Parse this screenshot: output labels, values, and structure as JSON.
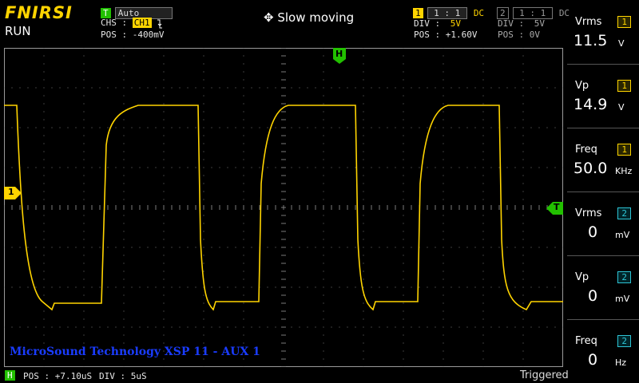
{
  "brand": "FNIRSI",
  "state": "RUN",
  "trigger": {
    "tag": "T",
    "mode": "Auto",
    "chs_label": "CHS :",
    "chs_value": "CH1",
    "edge_icon": "falling-edge-icon",
    "pos_label": "POS :",
    "pos_value": "-400mV"
  },
  "move_mode": "Slow moving",
  "ch1": {
    "num": "1",
    "probe": "1 : 1",
    "coupling": "DC",
    "div_label": "DIV :",
    "div": "5V",
    "pos_label": "POS :",
    "pos": "+1.60V"
  },
  "ch2": {
    "num": "2",
    "probe": "1 : 1",
    "coupling": "DC",
    "div_label": "DIV :",
    "div": "5V",
    "pos_label": "POS :",
    "pos": "0V"
  },
  "markers": {
    "h": "H",
    "ch1": "1",
    "t": "T"
  },
  "watermark": "MicroSound Technology XSP 11 - AUX 1",
  "bottom": {
    "h": "H",
    "pos_label": "POS :",
    "pos": "+7.10uS",
    "div_label": "DIV :",
    "div": "5uS",
    "status": "Triggered"
  },
  "measurements": [
    {
      "label": "Vrms",
      "ch": "1",
      "value": "11.5",
      "unit": "V"
    },
    {
      "label": "Vp",
      "ch": "1",
      "value": "14.9",
      "unit": "V"
    },
    {
      "label": "Freq",
      "ch": "1",
      "value": "50.0",
      "unit": "KHz"
    },
    {
      "label": "Vrms",
      "ch": "2",
      "value": "0",
      "unit": "mV"
    },
    {
      "label": "Vp",
      "ch": "2",
      "value": "0",
      "unit": "mV"
    },
    {
      "label": "Freq",
      "ch": "2",
      "value": "0",
      "unit": "Hz"
    }
  ],
  "colors": {
    "ch1": "#ffd400",
    "ch2": "#2ec5d6",
    "trigger": "#22c000",
    "grid": "#888888"
  }
}
